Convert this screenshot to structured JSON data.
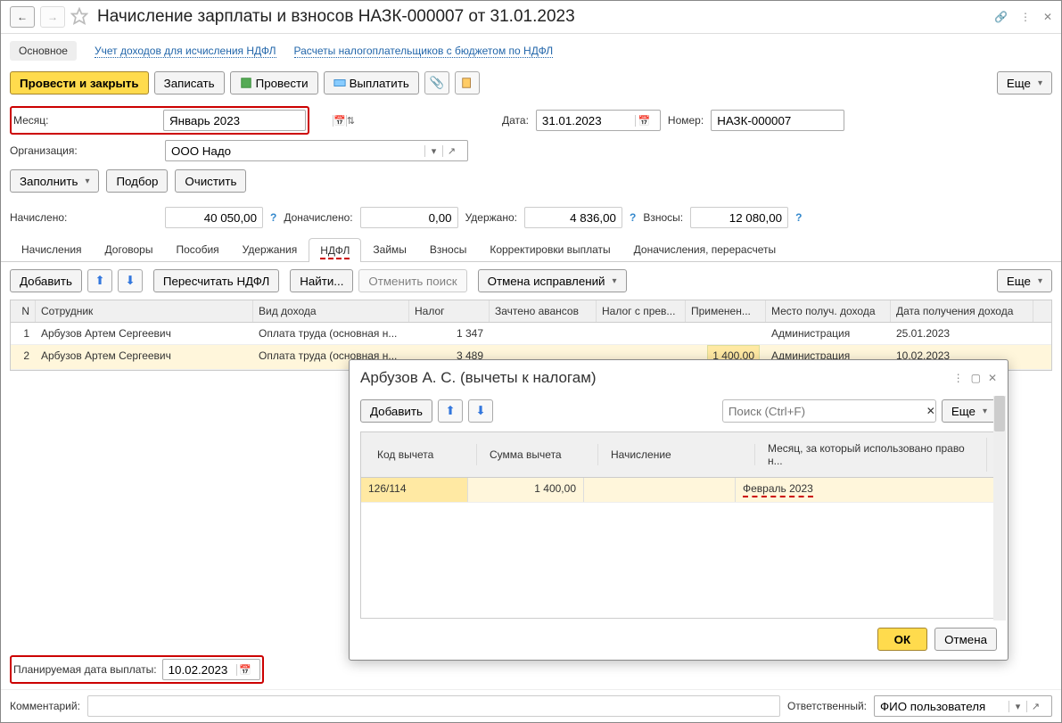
{
  "header": {
    "title": "Начисление зарплаты и взносов НАЗК-000007 от 31.01.2023"
  },
  "subnav": {
    "main": "Основное",
    "link1": "Учет доходов для исчисления НДФЛ",
    "link2": "Расчеты налогоплательщиков с бюджетом по НДФЛ"
  },
  "toolbar": {
    "post_close": "Провести и закрыть",
    "write": "Записать",
    "post": "Провести",
    "pay": "Выплатить",
    "more": "Еще"
  },
  "form": {
    "month_label": "Месяц:",
    "month_value": "Январь 2023",
    "date_label": "Дата:",
    "date_value": "31.01.2023",
    "number_label": "Номер:",
    "number_value": "НАЗК-000007",
    "org_label": "Организация:",
    "org_value": "ООО Надо",
    "fill": "Заполнить",
    "select": "Подбор",
    "clear": "Очистить"
  },
  "totals": {
    "accrued_label": "Начислено:",
    "accrued": "40 050,00",
    "extra_label": "Доначислено:",
    "extra": "0,00",
    "withheld_label": "Удержано:",
    "withheld": "4 836,00",
    "contrib_label": "Взносы:",
    "contrib": "12 080,00"
  },
  "tabs": [
    "Начисления",
    "Договоры",
    "Пособия",
    "Удержания",
    "НДФЛ",
    "Займы",
    "Взносы",
    "Корректировки выплаты",
    "Доначисления, перерасчеты"
  ],
  "subtoolbar": {
    "add": "Добавить",
    "recalc": "Пересчитать НДФЛ",
    "find": "Найти...",
    "cancel_find": "Отменить поиск",
    "cancel_fix": "Отмена исправлений",
    "more": "Еще"
  },
  "grid": {
    "headers": [
      "N",
      "Сотрудник",
      "Вид дохода",
      "Налог",
      "Зачтено авансов",
      "Налог с прев...",
      "Применен...",
      "Место получ. дохода",
      "Дата получения дохода"
    ],
    "rows": [
      {
        "n": "1",
        "emp": "Арбузов Артем Сергеевич",
        "inc": "Оплата труда (основная н...",
        "tax": "1 347",
        "adv": "",
        "exc": "",
        "app": "",
        "place": "Администрация",
        "date": "25.01.2023"
      },
      {
        "n": "2",
        "emp": "Арбузов Артем Сергеевич",
        "inc": "Оплата труда (основная н...",
        "tax": "3 489",
        "adv": "",
        "exc": "",
        "app": "1 400,00",
        "place": "Администрация",
        "date": "10.02.2023"
      }
    ]
  },
  "popup": {
    "title": "Арбузов А. С. (вычеты к налогам)",
    "add": "Добавить",
    "search_ph": "Поиск (Ctrl+F)",
    "more": "Еще",
    "headers": [
      "Код вычета",
      "Сумма вычета",
      "Начисление",
      "Месяц, за который использовано право н..."
    ],
    "row": {
      "code": "126/114",
      "sum": "1 400,00",
      "acc": "",
      "month": "Февраль 2023"
    },
    "ok": "ОК",
    "cancel": "Отмена"
  },
  "bottom": {
    "plan_label": "Планируемая дата выплаты:",
    "plan_value": "10.02.2023",
    "comment_label": "Комментарий:",
    "resp_label": "Ответственный:",
    "resp_value": "ФИО пользователя"
  }
}
